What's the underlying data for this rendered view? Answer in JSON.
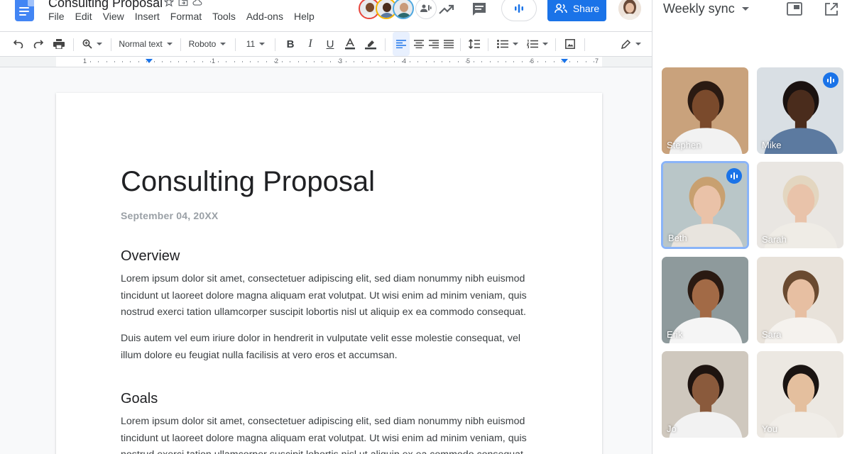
{
  "document": {
    "title": "Consulting Proposal",
    "menu": [
      "File",
      "Edit",
      "View",
      "Insert",
      "Format",
      "Tools",
      "Add-ons",
      "Help"
    ],
    "share_label": "Share",
    "toolbar": {
      "style": "Normal text",
      "font": "Roboto",
      "size": "11"
    },
    "ruler_numbers": [
      "1",
      "1",
      "2",
      "3",
      "4",
      "5",
      "6",
      "7"
    ],
    "heading": "Consulting Proposal",
    "date": "September 04, 20XX",
    "sections": [
      {
        "title": "Overview",
        "paragraphs": [
          "Lorem ipsum dolor sit amet, consectetuer adipiscing elit, sed diam nonummy nibh euismod\ntincidunt ut laoreet dolore magna aliquam erat volutpat. Ut wisi enim ad minim veniam, quis\nnostrud exerci tation ullamcorper suscipit lobortis nisl ut aliquip ex ea commodo consequat.",
          "Duis autem vel eum iriure dolor in hendrerit in vulputate velit esse molestie consequat, vel\nillum dolore eu feugiat nulla facilisis at vero eros et accumsan."
        ]
      },
      {
        "title": "Goals",
        "paragraphs": [
          "Lorem ipsum dolor sit amet, consectetuer adipiscing elit, sed diam nonummy nibh euismod\ntincidunt ut laoreet dolore magna aliquam erat volutpat. Ut wisi enim ad minim veniam, quis\nnostrud exerci tation ullamcorper suscipit lobortis nisl ut aliquip ex ea commodo consequat."
        ]
      }
    ]
  },
  "meet": {
    "title": "Weekly sync",
    "participants": [
      {
        "name": "Stephen",
        "speaking": false,
        "active": false,
        "bg": "#c9a27c",
        "skin": "#7a4a2c",
        "shirt": "#f2f2f2",
        "hair": "#2a1a12"
      },
      {
        "name": "Mike",
        "speaking": true,
        "active": false,
        "bg": "#d9dfe4",
        "skin": "#4a2c1c",
        "shirt": "#5c7aa0",
        "hair": "#1a1210"
      },
      {
        "name": "Beth",
        "speaking": true,
        "active": true,
        "bg": "#b9c6c8",
        "skin": "#eac2a8",
        "shirt": "#e8e4de",
        "hair": "#c8a070"
      },
      {
        "name": "Sarah",
        "speaking": false,
        "active": false,
        "bg": "#e9e6e2",
        "skin": "#e9c3aa",
        "shirt": "#efece6",
        "hair": "#e3d6c0"
      },
      {
        "name": "Erik",
        "speaking": false,
        "active": false,
        "bg": "#8e9a9c",
        "skin": "#a26a46",
        "shirt": "#f5f5f5",
        "hair": "#2a1a12"
      },
      {
        "name": "Sara",
        "speaking": false,
        "active": false,
        "bg": "#e8e2da",
        "skin": "#e7bfa2",
        "shirt": "#f5f2ee",
        "hair": "#6a4a30"
      },
      {
        "name": "Jo",
        "speaking": false,
        "active": false,
        "bg": "#cfc8be",
        "skin": "#8a5a3c",
        "shirt": "#f2f2f2",
        "hair": "#1e1410"
      },
      {
        "name": "You",
        "speaking": false,
        "active": false,
        "bg": "#ece8e2",
        "skin": "#e4bf9e",
        "shirt": "#f0ede8",
        "hair": "#1a1412"
      }
    ]
  },
  "colors": {
    "accent": "#1a73e8",
    "active_tile_border": "#8ab4f8"
  }
}
